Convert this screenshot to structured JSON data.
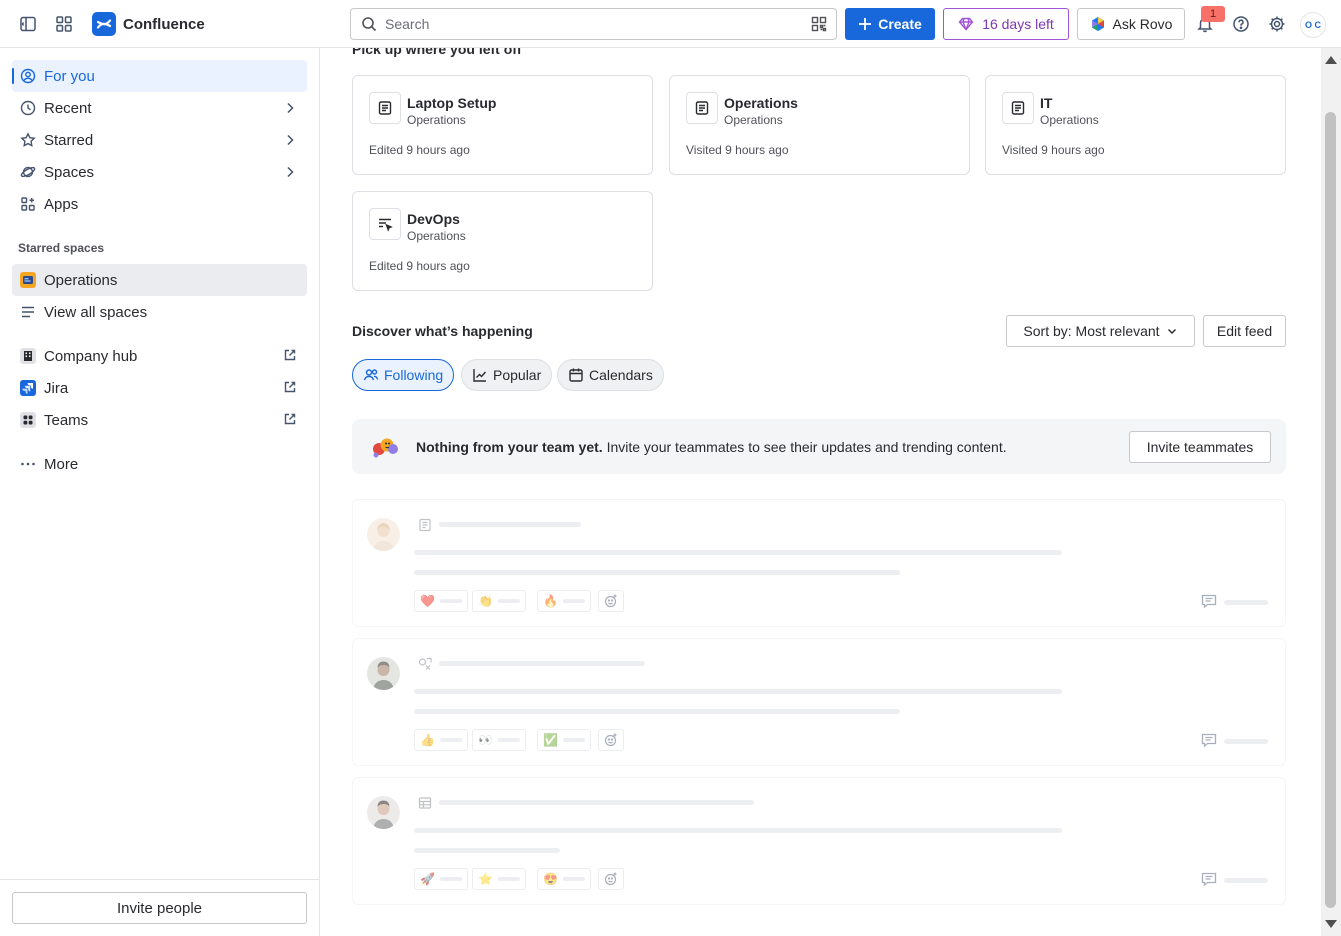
{
  "header": {
    "app_name": "Confluence",
    "search_placeholder": "Search",
    "create_label": "Create",
    "trial_label": "16 days left",
    "rovo_label": "Ask Rovo",
    "notification_count": "1",
    "avatar_initials_top": "O C",
    "colors": {
      "brand": "#1868db",
      "trial": "#7f35b2"
    }
  },
  "sidebar": {
    "items": [
      {
        "label": "For you",
        "icon": "user-circle-icon",
        "active": true
      },
      {
        "label": "Recent",
        "icon": "clock-icon",
        "chevron": true
      },
      {
        "label": "Starred",
        "icon": "star-icon",
        "chevron": true
      },
      {
        "label": "Spaces",
        "icon": "planet-icon",
        "chevron": true
      },
      {
        "label": "Apps",
        "icon": "apps-icon"
      }
    ],
    "starred_spaces_label": "Starred spaces",
    "starred_spaces": [
      {
        "label": "Operations",
        "icon": "operations-space-icon"
      }
    ],
    "view_all_label": "View all spaces",
    "external_apps": [
      {
        "label": "Company hub",
        "icon": "company-hub-icon"
      },
      {
        "label": "Jira",
        "icon": "jira-icon"
      },
      {
        "label": "Teams",
        "icon": "teams-icon"
      }
    ],
    "more_label": "More",
    "invite_label": "Invite people"
  },
  "main": {
    "pickup_title": "Pick up where you left off",
    "recent_cards": [
      {
        "title": "Laptop Setup",
        "space": "Operations",
        "meta": "Edited 9 hours ago",
        "icon": "page-icon"
      },
      {
        "title": "Operations",
        "space": "Operations",
        "meta": "Visited 9 hours ago",
        "icon": "page-icon"
      },
      {
        "title": "IT",
        "space": "Operations",
        "meta": "Visited 9 hours ago",
        "icon": "page-icon"
      },
      {
        "title": "DevOps",
        "space": "Operations",
        "meta": "Edited 9 hours ago",
        "icon": "live-doc-icon"
      }
    ],
    "discover_title": "Discover what’s happening",
    "sort_label": "Sort by: Most relevant",
    "edit_feed_label": "Edit feed",
    "feed_tabs": [
      {
        "label": "Following",
        "icon": "people-icon",
        "active": true
      },
      {
        "label": "Popular",
        "icon": "trend-icon"
      },
      {
        "label": "Calendars",
        "icon": "calendar-icon"
      }
    ],
    "banner": {
      "bold": "Nothing from your team yet.",
      "text": " Invite your teammates to see their updates and trending content.",
      "button": "Invite teammates"
    },
    "feed_placeholders": [
      {
        "reactions": [
          "❤️",
          "👏",
          "🔥"
        ]
      },
      {
        "reactions": [
          "👍",
          "👀",
          "✅"
        ]
      },
      {
        "reactions": [
          "🚀",
          "⭐",
          "😍"
        ]
      }
    ]
  }
}
